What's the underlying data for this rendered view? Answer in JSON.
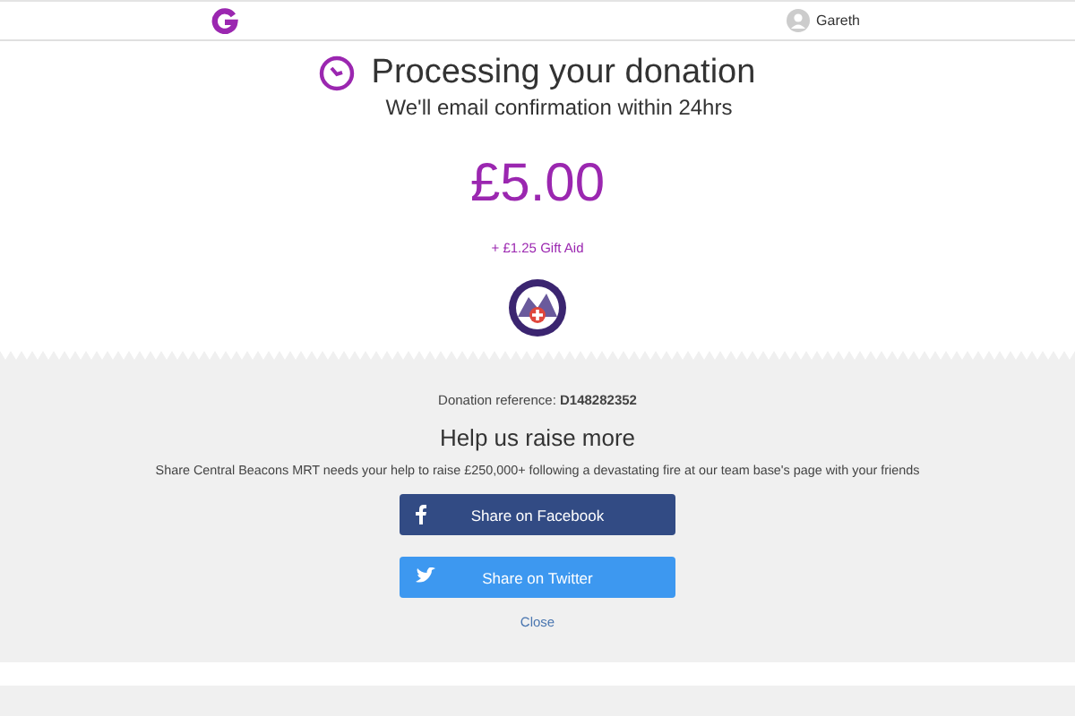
{
  "header": {
    "user": "Gareth"
  },
  "status": {
    "title": "Processing your donation",
    "subtitle": "We'll email confirmation within 24hrs",
    "amount": "£5.00",
    "gift_aid": "+ £1.25 Gift Aid"
  },
  "share": {
    "reference_label": "Donation reference:",
    "reference": "D148282352",
    "heading": "Help us raise more",
    "text": "Share Central Beacons MRT needs your help to raise £250,000+ following a devastating fire at our team base's page with your friends",
    "buttons": [
      {
        "kind": "facebook",
        "label": "Share on Facebook"
      },
      {
        "kind": "twitter",
        "label": "Share on Twitter"
      }
    ],
    "close": "Close"
  }
}
